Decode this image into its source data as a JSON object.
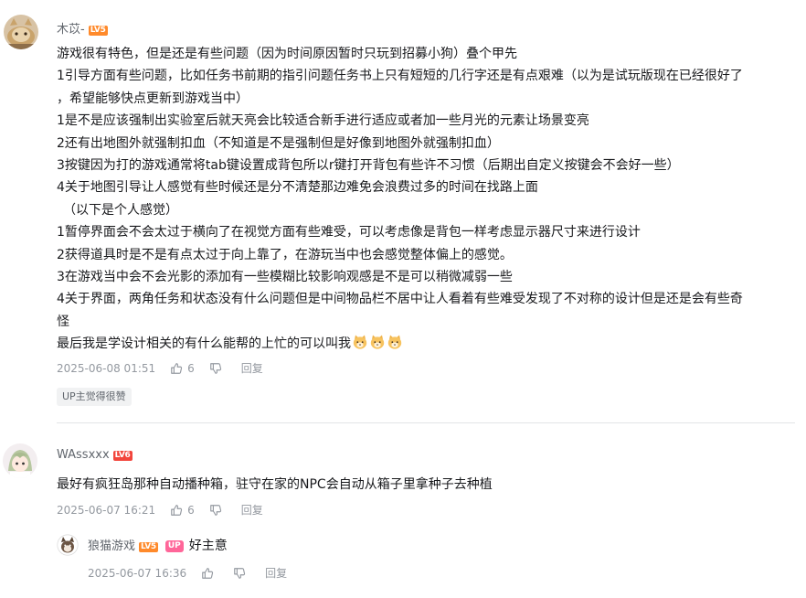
{
  "comments": [
    {
      "username": "木苡-",
      "level": "LV5",
      "lines": [
        "游戏很有特色，但是还是有些问题（因为时间原因暂时只玩到招募小狗）叠个甲先",
        "1引导方面有些问题，比如任务书前期的指引问题任务书上只有短短的几行字还是有点艰难（以为是试玩版现在已经很好了",
        "，希望能够快点更新到游戏当中）",
        "1是不是应该强制出实验室后就天亮会比较适合新手进行适应或者加一些月光的元素让场景变亮",
        "2还有出地图外就强制扣血（不知道是不是强制但是好像到地图外就强制扣血）",
        "3按键因为打的游戏通常将tab键设置成背包所以r键打开背包有些许不习惯（后期出自定义按键会不会好一些）",
        "4关于地图引导让人感觉有些时候还是分不清楚那边难免会浪费过多的时间在找路上面",
        "（以下是个人感觉）",
        "1暂停界面会不会太过于横向了在视觉方面有些难受，可以考虑像是背包一样考虑显示器尺寸来进行设计",
        "2获得道具时是不是有点太过于向上靠了，在游玩当中也会感觉整体偏上的感觉。",
        "3在游戏当中会不会光影的添加有一些模糊比较影响观感是不是可以稍微减弱一些",
        "4关于界面，两角任务和状态没有什么问题但是中间物品栏不居中让人看着有些难受发现了不对称的设计但是还是会有些奇",
        "怪",
        "最后我是学设计相关的有什么能帮的上忙的可以叫我"
      ],
      "emoji_count": 3,
      "time": "2025-06-08 01:51",
      "likes": "6",
      "reply_label": "回复",
      "tag": "UP主觉得很赞"
    },
    {
      "username": "WAssxxx",
      "level": "LV6",
      "text": "最好有疯狂岛那种自动播种箱，驻守在家的NPC会自动从箱子里拿种子去种植",
      "time": "2025-06-07 16:21",
      "likes": "6",
      "reply_label": "回复"
    }
  ],
  "reply": {
    "username": "狼猫游戏",
    "level": "LV5",
    "badge": "UP",
    "text": "好主意",
    "time": "2025-06-07 16:36",
    "reply_label": "回复"
  },
  "colors": {
    "lv5": "#ff8a2b",
    "lv6": "#f2453c",
    "up_badge": "#ff6699",
    "meta_text": "#9499a0"
  }
}
